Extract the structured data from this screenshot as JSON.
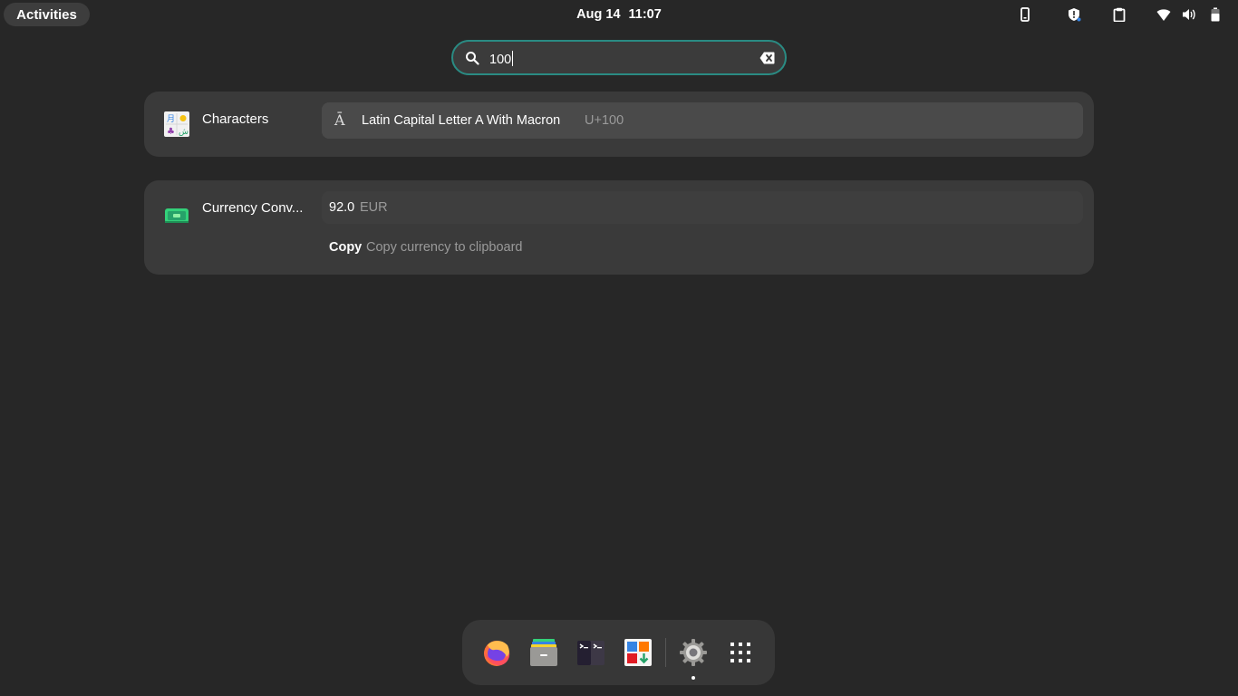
{
  "topbar": {
    "activities_label": "Activities",
    "date": "Aug 14",
    "time": "11:07",
    "tray_icons": [
      "phone-icon",
      "privacy-shield-icon",
      "clipboard-icon",
      "wifi-icon",
      "volume-icon",
      "battery-icon"
    ]
  },
  "search": {
    "value": "100",
    "icon": "search-icon",
    "clear_icon": "clear-text-icon"
  },
  "results": {
    "characters": {
      "app_name": "Characters",
      "app_icon": "characters-app-icon",
      "item": {
        "glyph": "Ā",
        "title": "Latin Capital Letter A With Macron",
        "code": "U+100"
      }
    },
    "currency": {
      "app_name": "Currency Conv...",
      "app_icon": "currency-converter-icon",
      "item": {
        "value": "92.0",
        "unit": "EUR"
      },
      "action": {
        "label": "Copy",
        "description": "Copy currency to clipboard"
      }
    }
  },
  "dock": {
    "items": [
      "firefox-icon",
      "file-manager-icon",
      "terminal-icon",
      "software-center-icon",
      "settings-icon",
      "app-grid-icon"
    ]
  },
  "colors": {
    "background": "#272727",
    "accent": "#2a8b83",
    "panel": "#3a3a3a"
  }
}
